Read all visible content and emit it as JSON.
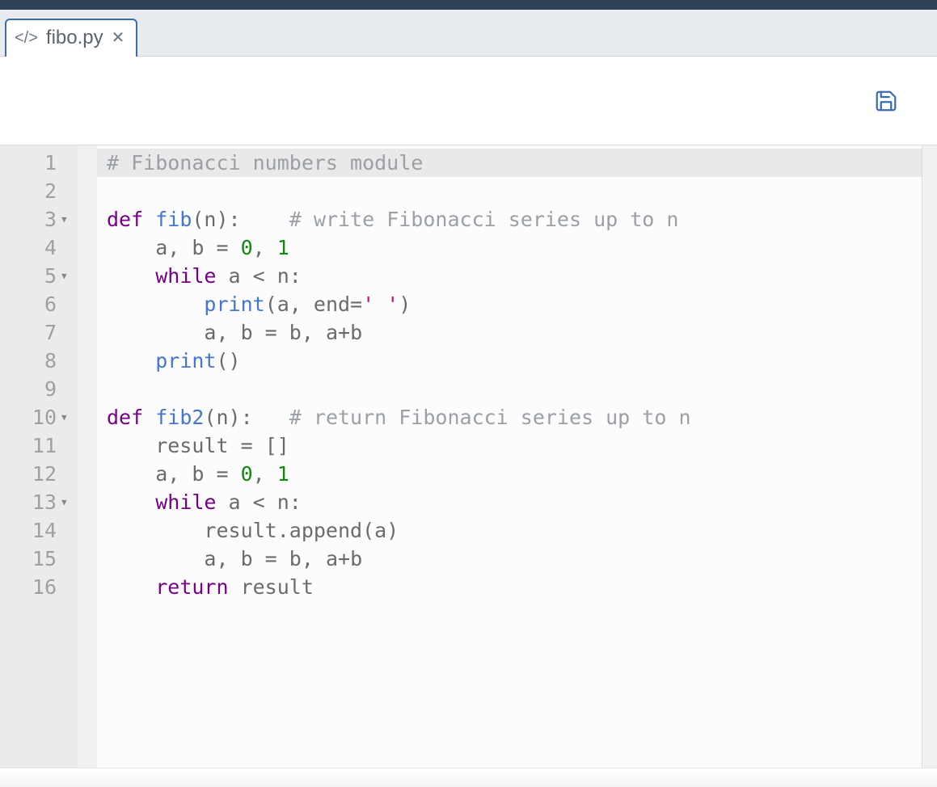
{
  "tab": {
    "filename": "fibo.py",
    "icon": "</>"
  },
  "lines": [
    {
      "n": 1,
      "fold": false,
      "tokens": [
        {
          "t": "# Fibonacci numbers module",
          "cls": "tok-comment"
        }
      ],
      "hl": true
    },
    {
      "n": 2,
      "fold": false,
      "tokens": []
    },
    {
      "n": 3,
      "fold": true,
      "tokens": [
        {
          "t": "def",
          "cls": "tok-keyword"
        },
        {
          "t": " "
        },
        {
          "t": "fib",
          "cls": "tok-def"
        },
        {
          "t": "(n):    "
        },
        {
          "t": "# write Fibonacci series up to n",
          "cls": "tok-comment"
        }
      ]
    },
    {
      "n": 4,
      "fold": false,
      "tokens": [
        {
          "t": "    a, b "
        },
        {
          "t": "=",
          "cls": "tok-op"
        },
        {
          "t": " "
        },
        {
          "t": "0",
          "cls": "tok-num"
        },
        {
          "t": ", "
        },
        {
          "t": "1",
          "cls": "tok-num"
        }
      ]
    },
    {
      "n": 5,
      "fold": true,
      "tokens": [
        {
          "t": "    "
        },
        {
          "t": "while",
          "cls": "tok-keyword"
        },
        {
          "t": " a "
        },
        {
          "t": "<",
          "cls": "tok-op"
        },
        {
          "t": " n:"
        }
      ]
    },
    {
      "n": 6,
      "fold": false,
      "tokens": [
        {
          "t": "        "
        },
        {
          "t": "print",
          "cls": "tok-funcname"
        },
        {
          "t": "(a, end"
        },
        {
          "t": "=",
          "cls": "tok-op"
        },
        {
          "t": "' '",
          "cls": "tok-str"
        },
        {
          "t": ")"
        }
      ]
    },
    {
      "n": 7,
      "fold": false,
      "tokens": [
        {
          "t": "        a, b "
        },
        {
          "t": "=",
          "cls": "tok-op"
        },
        {
          "t": " b, a"
        },
        {
          "t": "+",
          "cls": "tok-op"
        },
        {
          "t": "b"
        }
      ]
    },
    {
      "n": 8,
      "fold": false,
      "tokens": [
        {
          "t": "    "
        },
        {
          "t": "print",
          "cls": "tok-funcname"
        },
        {
          "t": "()"
        }
      ]
    },
    {
      "n": 9,
      "fold": false,
      "tokens": []
    },
    {
      "n": 10,
      "fold": true,
      "tokens": [
        {
          "t": "def",
          "cls": "tok-keyword"
        },
        {
          "t": " "
        },
        {
          "t": "fib2",
          "cls": "tok-def"
        },
        {
          "t": "(n):   "
        },
        {
          "t": "# return Fibonacci series up to n",
          "cls": "tok-comment"
        }
      ]
    },
    {
      "n": 11,
      "fold": false,
      "tokens": [
        {
          "t": "    result "
        },
        {
          "t": "=",
          "cls": "tok-op"
        },
        {
          "t": " []"
        }
      ]
    },
    {
      "n": 12,
      "fold": false,
      "tokens": [
        {
          "t": "    a, b "
        },
        {
          "t": "=",
          "cls": "tok-op"
        },
        {
          "t": " "
        },
        {
          "t": "0",
          "cls": "tok-num"
        },
        {
          "t": ", "
        },
        {
          "t": "1",
          "cls": "tok-num"
        }
      ]
    },
    {
      "n": 13,
      "fold": true,
      "tokens": [
        {
          "t": "    "
        },
        {
          "t": "while",
          "cls": "tok-keyword"
        },
        {
          "t": " a "
        },
        {
          "t": "<",
          "cls": "tok-op"
        },
        {
          "t": " n:"
        }
      ]
    },
    {
      "n": 14,
      "fold": false,
      "tokens": [
        {
          "t": "        result.append(a)"
        }
      ]
    },
    {
      "n": 15,
      "fold": false,
      "tokens": [
        {
          "t": "        a, b "
        },
        {
          "t": "=",
          "cls": "tok-op"
        },
        {
          "t": " b, a"
        },
        {
          "t": "+",
          "cls": "tok-op"
        },
        {
          "t": "b"
        }
      ]
    },
    {
      "n": 16,
      "fold": false,
      "tokens": [
        {
          "t": "    "
        },
        {
          "t": "return",
          "cls": "tok-keyword"
        },
        {
          "t": " result"
        }
      ]
    }
  ]
}
